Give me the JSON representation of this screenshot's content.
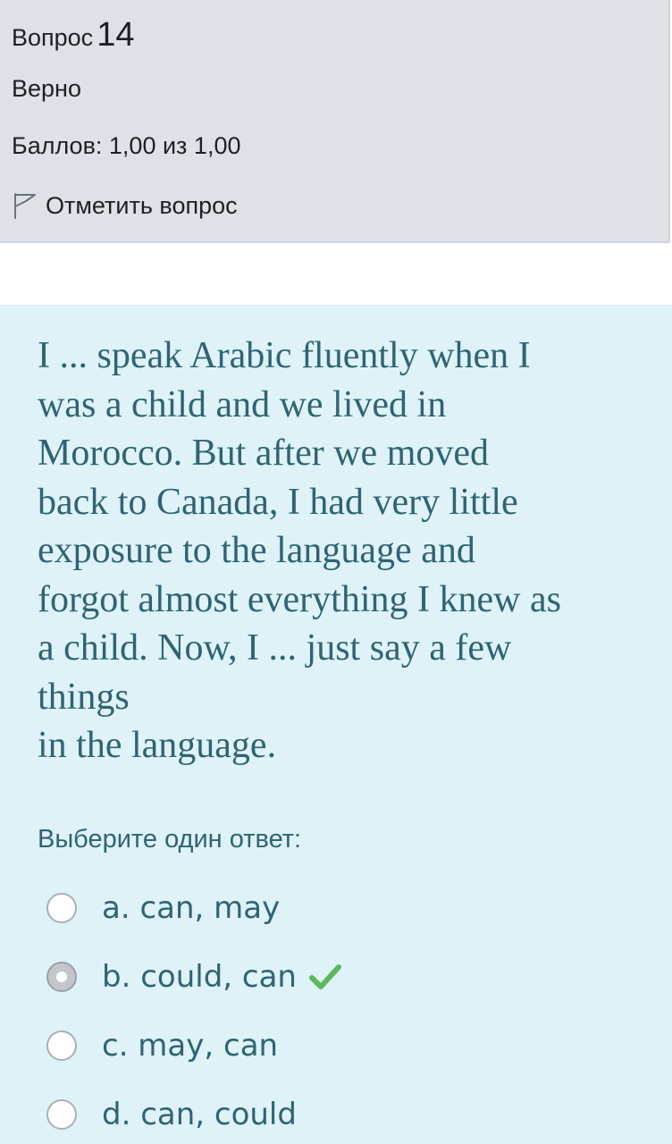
{
  "info": {
    "question_label": "Вопрос",
    "question_number": "14",
    "state": "Верно",
    "grade": "Баллов: 1,00 из 1,00",
    "flag_label": "Отметить вопрос",
    "flag_icon": "flag-outline-icon"
  },
  "question": {
    "text_lines": [
      "I ... speak Arabic fluently when I",
      "was a child and we lived in",
      "Morocco. But after we moved",
      "back to Canada, I had very little",
      "exposure to the language and",
      "forgot almost everything I knew as",
      "a child. Now, I ... just say a few",
      "things",
      "in the language."
    ],
    "prompt": "Выберите один ответ:",
    "answers": [
      {
        "label": "a. can, may",
        "selected": false,
        "correct": false
      },
      {
        "label": "b. could, can",
        "selected": true,
        "correct": true
      },
      {
        "label": "c. may, can",
        "selected": false,
        "correct": false
      },
      {
        "label": "d. can, could",
        "selected": false,
        "correct": false
      }
    ]
  },
  "colors": {
    "info_background": "#dee2e6",
    "question_background": "#def2f8",
    "question_text": "#2f6473",
    "correct_check": "#5cb85c"
  }
}
